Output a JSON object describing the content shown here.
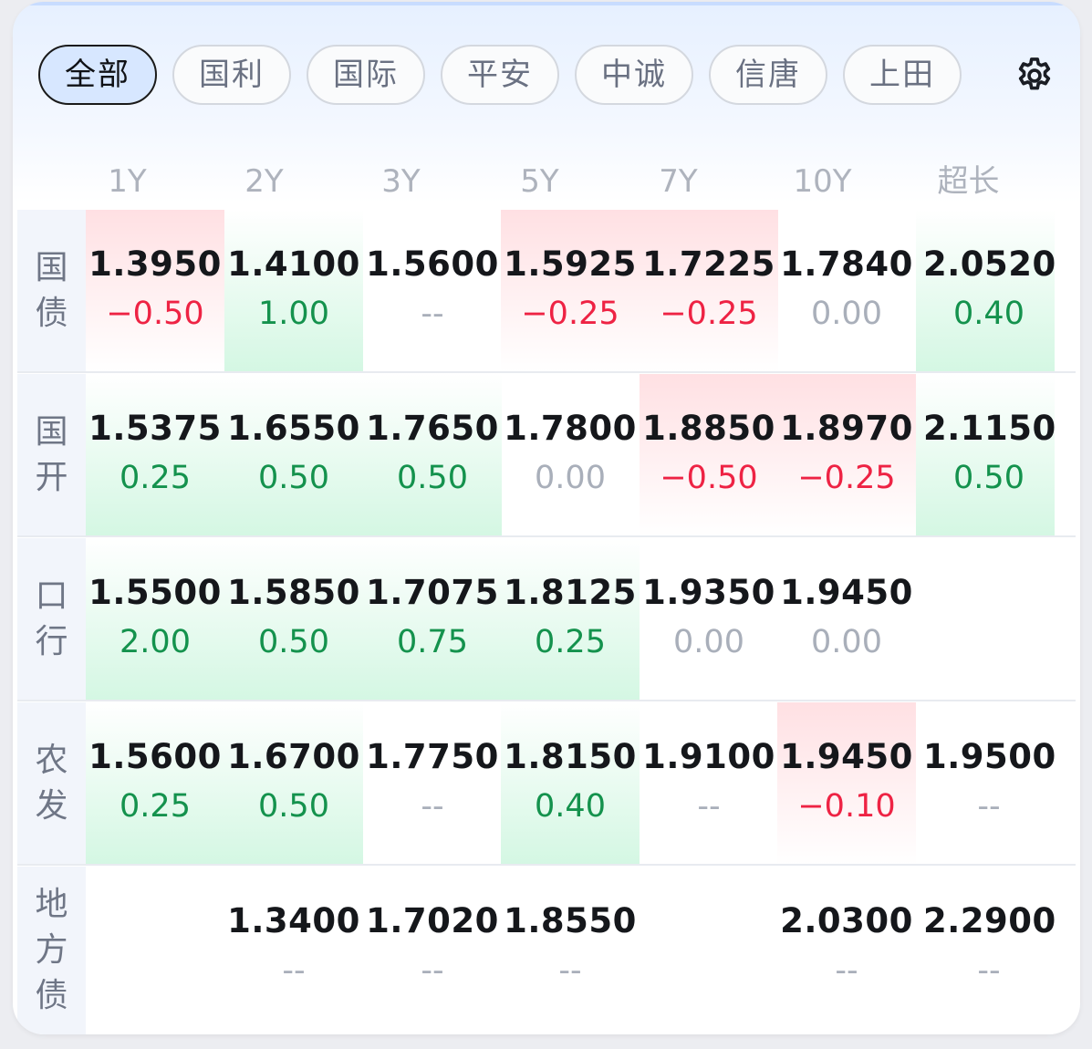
{
  "tabs": [
    "全部",
    "国利",
    "国际",
    "平安",
    "中诚",
    "信唐",
    "上田"
  ],
  "active_tab": "全部",
  "settings_icon": "gear-icon",
  "columns": [
    "1Y",
    "2Y",
    "3Y",
    "5Y",
    "7Y",
    "10Y",
    "超长"
  ],
  "colors": {
    "up": "#ee2344",
    "down": "#14924d",
    "flat": "#a9afba"
  },
  "rows": [
    {
      "label": "国债",
      "cells": [
        {
          "v": "1.3950",
          "c": "−0.50",
          "dir": "up"
        },
        {
          "v": "1.4100",
          "c": "1.00",
          "dir": "down"
        },
        {
          "v": "1.5600",
          "c": "--",
          "dir": "flat"
        },
        {
          "v": "1.5925",
          "c": "−0.25",
          "dir": "up"
        },
        {
          "v": "1.7225",
          "c": "−0.25",
          "dir": "up"
        },
        {
          "v": "1.7840",
          "c": "0.00",
          "dir": "flat"
        },
        {
          "v": "2.0520",
          "c": "0.40",
          "dir": "down"
        }
      ]
    },
    {
      "label": "国开",
      "cells": [
        {
          "v": "1.5375",
          "c": "0.25",
          "dir": "down"
        },
        {
          "v": "1.6550",
          "c": "0.50",
          "dir": "down"
        },
        {
          "v": "1.7650",
          "c": "0.50",
          "dir": "down"
        },
        {
          "v": "1.7800",
          "c": "0.00",
          "dir": "flat"
        },
        {
          "v": "1.8850",
          "c": "−0.50",
          "dir": "up"
        },
        {
          "v": "1.8970",
          "c": "−0.25",
          "dir": "up"
        },
        {
          "v": "2.1150",
          "c": "0.50",
          "dir": "down"
        }
      ]
    },
    {
      "label": "口行",
      "cells": [
        {
          "v": "1.5500",
          "c": "2.00",
          "dir": "down"
        },
        {
          "v": "1.5850",
          "c": "0.50",
          "dir": "down"
        },
        {
          "v": "1.7075",
          "c": "0.75",
          "dir": "down"
        },
        {
          "v": "1.8125",
          "c": "0.25",
          "dir": "down"
        },
        {
          "v": "1.9350",
          "c": "0.00",
          "dir": "flat"
        },
        {
          "v": "1.9450",
          "c": "0.00",
          "dir": "flat"
        },
        {
          "v": "",
          "c": "",
          "dir": "none"
        }
      ]
    },
    {
      "label": "农发",
      "cells": [
        {
          "v": "1.5600",
          "c": "0.25",
          "dir": "down"
        },
        {
          "v": "1.6700",
          "c": "0.50",
          "dir": "down"
        },
        {
          "v": "1.7750",
          "c": "--",
          "dir": "flat"
        },
        {
          "v": "1.8150",
          "c": "0.40",
          "dir": "down"
        },
        {
          "v": "1.9100",
          "c": "--",
          "dir": "flat"
        },
        {
          "v": "1.9450",
          "c": "−0.10",
          "dir": "up"
        },
        {
          "v": "1.9500",
          "c": "--",
          "dir": "flat"
        }
      ]
    },
    {
      "label": "地方债",
      "cells": [
        {
          "v": "",
          "c": "",
          "dir": "none"
        },
        {
          "v": "1.3400",
          "c": "--",
          "dir": "flat"
        },
        {
          "v": "1.7020",
          "c": "--",
          "dir": "flat"
        },
        {
          "v": "1.8550",
          "c": "--",
          "dir": "flat"
        },
        {
          "v": "",
          "c": "",
          "dir": "none"
        },
        {
          "v": "2.0300",
          "c": "--",
          "dir": "flat"
        },
        {
          "v": "2.2900",
          "c": "--",
          "dir": "flat"
        }
      ]
    }
  ]
}
